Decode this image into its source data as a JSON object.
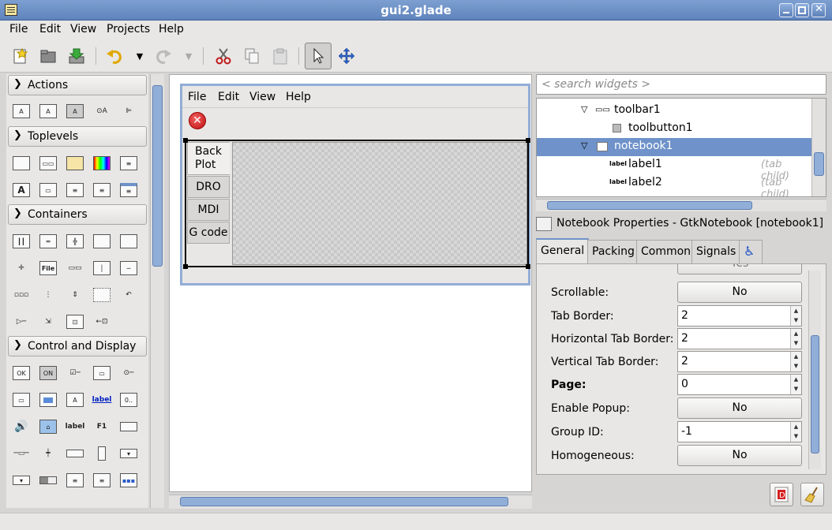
{
  "window": {
    "title": "gui2.glade"
  },
  "menubar": [
    "File",
    "Edit",
    "View",
    "Projects",
    "Help"
  ],
  "palette": {
    "groups": [
      "Actions",
      "Toplevels",
      "Containers",
      "Control and Display"
    ],
    "icon_labels": {
      "file": "File",
      "ok": "OK",
      "on": "ON",
      "label_link": "label",
      "label_plain": "label",
      "f1": "F1",
      "digits": "0..",
      "a": "A"
    }
  },
  "design": {
    "menubar": [
      "File",
      "Edit",
      "View",
      "Help"
    ],
    "notebook_tabs": [
      "Back\nPlot",
      "DRO",
      "MDI",
      "G code"
    ]
  },
  "search": {
    "placeholder": "< search widgets >"
  },
  "tree": {
    "rows": [
      {
        "label": "toolbar1",
        "note": ""
      },
      {
        "label": "toolbutton1",
        "note": ""
      },
      {
        "label": "notebook1",
        "note": ""
      },
      {
        "label": "label1",
        "note": "(tab child)"
      },
      {
        "label": "label2",
        "note": "(tab child)"
      }
    ],
    "icon_label": "label"
  },
  "properties": {
    "title": "Notebook Properties - GtkNotebook [notebook1]",
    "tabs": [
      "General",
      "Packing",
      "Common",
      "Signals"
    ],
    "rows": [
      {
        "label": "Scrollable:",
        "value": "No",
        "kind": "button"
      },
      {
        "label": "Tab Border:",
        "value": "2",
        "kind": "spin"
      },
      {
        "label": "Horizontal Tab Border:",
        "value": "2",
        "kind": "spin"
      },
      {
        "label": "Vertical Tab Border:",
        "value": "2",
        "kind": "spin"
      },
      {
        "label": "Page:",
        "value": "0",
        "kind": "spin"
      },
      {
        "label": "Enable Popup:",
        "value": "No",
        "kind": "button"
      },
      {
        "label": "Group ID:",
        "value": "-1",
        "kind": "spin"
      },
      {
        "label": "Homogeneous:",
        "value": "No",
        "kind": "button"
      }
    ],
    "partial_row": "Yes"
  }
}
